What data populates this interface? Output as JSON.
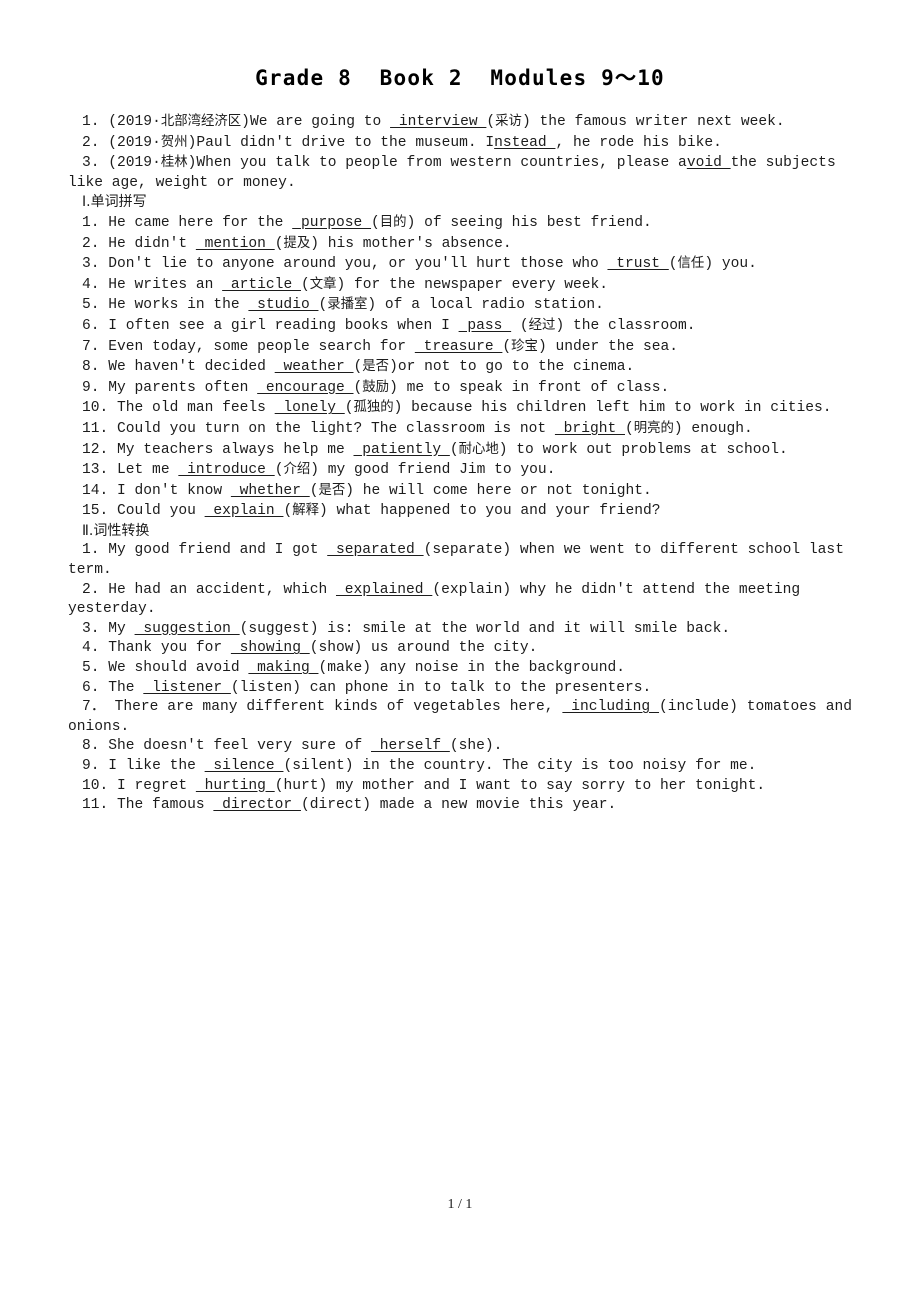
{
  "document": {
    "title": "Grade 8  Book 2  Modules 9～10",
    "footer": "1 / 1"
  },
  "intro_exercises": [
    {
      "number": "1.",
      "source": "(2019·北部湾经济区)",
      "before": "We are going to ",
      "blank": " interview ",
      "after": "(采访) the famous writer next week."
    },
    {
      "number": "2.",
      "source": "(2019·贺州)",
      "before": "Paul didn't drive to the museum. I",
      "blank": "nstead ",
      "after": ", he rode his bike."
    },
    {
      "number": "3.",
      "source": "(2019·桂林)",
      "before": "When you talk to people from western countries, please a",
      "blank": "void ",
      "after": "the subjects like age, weight or money."
    }
  ],
  "section_one": {
    "heading": "Ⅰ.单词拼写",
    "items": [
      {
        "number": "1.",
        "before": "He came here for the ",
        "blank": " purpose ",
        "after": "(目的) of seeing his best friend."
      },
      {
        "number": "2.",
        "before": "He didn't ",
        "blank": " mention ",
        "after": "(提及) his mother's absence."
      },
      {
        "number": "3.",
        "before": "Don't lie to anyone around you, or you'll hurt those who ",
        "blank": " trust ",
        "after": "(信任) you."
      },
      {
        "number": "4.",
        "before": "He writes an ",
        "blank": " article ",
        "after": "(文章) for the newspaper every week."
      },
      {
        "number": "5.",
        "before": "He works in the ",
        "blank": " studio ",
        "after": "(录播室) of a local radio station."
      },
      {
        "number": "6.",
        "before": "I often see a girl reading books when I ",
        "blank": " pass ",
        "after": " (经过) the classroom."
      },
      {
        "number": "7.",
        "before": "Even today, some people search for ",
        "blank": " treasure ",
        "after": "(珍宝) under the sea."
      },
      {
        "number": "8.",
        "before": "We haven't decided ",
        "blank": " weather ",
        "after": "(是否)or not to go to the cinema."
      },
      {
        "number": "9.",
        "before": "My parents often ",
        "blank": " encourage ",
        "after": "(鼓励) me to speak in front of class."
      },
      {
        "number": "10.",
        "before": "The old man feels ",
        "blank": " lonely ",
        "after": "(孤独的) because his children left him to work in cities."
      },
      {
        "number": "11.",
        "before": "Could you turn on the light? The classroom is not ",
        "blank": " bright ",
        "after": "(明亮的) enough."
      },
      {
        "number": "12.",
        "before": "My teachers always help me ",
        "blank": " patiently ",
        "after": "(耐心地) to work out problems at school."
      },
      {
        "number": "13.",
        "before": "Let me ",
        "blank": " introduce ",
        "after": "(介绍) my good friend Jim to you."
      },
      {
        "number": "14.",
        "before": "I don't know ",
        "blank": " whether ",
        "after": "(是否) he will come here or not tonight."
      },
      {
        "number": "15.",
        "before": "Could you ",
        "blank": " explain ",
        "after": "(解释) what happened to you and your friend?"
      }
    ]
  },
  "section_two": {
    "heading": "Ⅱ.词性转换",
    "items": [
      {
        "number": "1.",
        "before": "My good friend and I got ",
        "blank": " separated ",
        "after": "(separate) when we went to different school last term."
      },
      {
        "number": "2.",
        "before": "He had an accident, which ",
        "blank": " explained ",
        "after": "(explain) why he didn't attend the meeting yesterday."
      },
      {
        "number": "3.",
        "before": "My ",
        "blank": " suggestion ",
        "after": "(suggest) is: smile at the world and it will smile back."
      },
      {
        "number": "4.",
        "before": "Thank you for ",
        "blank": " showing ",
        "after": "(show) us around the city."
      },
      {
        "number": "5.",
        "before": "We should avoid ",
        "blank": " making ",
        "after": "(make) any noise in the background."
      },
      {
        "number": "6.",
        "before": "The ",
        "blank": " listener ",
        "after": "(listen) can phone in to talk to the presenters."
      },
      {
        "number": "7．",
        "before": "There are many different kinds of vegetables here, ",
        "blank": " including ",
        "after": "(include) tomatoes and onions.",
        "justify": true
      },
      {
        "number": "8.",
        "before": "She doesn't feel very sure of ",
        "blank": " herself ",
        "after": "(she)."
      },
      {
        "number": "9.",
        "before": "I like the ",
        "blank": " silence ",
        "after": "(silent) in the country. The city is too noisy for me."
      },
      {
        "number": "10.",
        "before": "I regret ",
        "blank": " hurting ",
        "after": "(hurt) my mother and I want to say sorry to her tonight."
      },
      {
        "number": "11.",
        "before": "The famous ",
        "blank": " director ",
        "after": "(direct) made a new movie this year."
      }
    ]
  }
}
